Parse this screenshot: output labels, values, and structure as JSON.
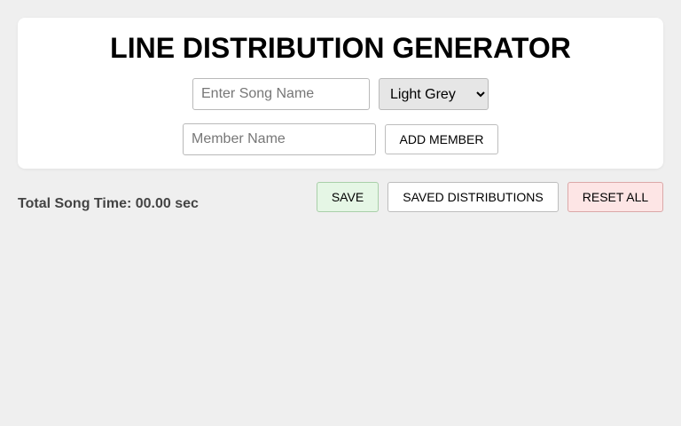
{
  "header": {
    "title": "LINE DISTRIBUTION GENERATOR"
  },
  "form": {
    "song_name_placeholder": "Enter Song Name",
    "song_name_value": "",
    "color_select": {
      "selected": "Light Grey",
      "options": [
        "Light Grey"
      ]
    },
    "member_name_placeholder": "Member Name",
    "member_name_value": "",
    "add_member_label": "ADD MEMBER"
  },
  "status": {
    "total_time_label": "Total Song Time:",
    "total_time_value": "00.00",
    "total_time_unit": "sec"
  },
  "actions": {
    "save_label": "SAVE",
    "saved_label": "SAVED DISTRIBUTIONS",
    "reset_label": "RESET ALL"
  },
  "colors": {
    "background": "#efefef",
    "card": "#ffffff",
    "save_bg": "#e5f6e5",
    "reset_bg": "#fde5e5"
  }
}
